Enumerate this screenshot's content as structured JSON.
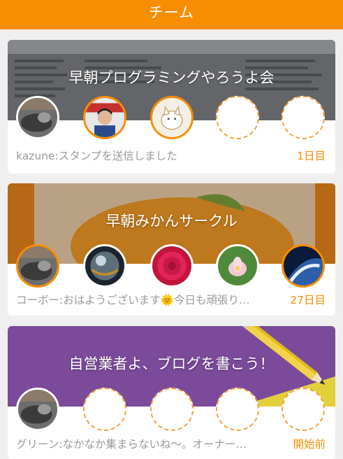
{
  "header": {
    "title": "チーム"
  },
  "teams": [
    {
      "name": "早朝プログラミングやろうよ会",
      "last_message": "kazune:スタンプを送信しました",
      "status": "1日目",
      "members": [
        "cat-photo",
        "person-photo",
        "cat-drawing",
        "empty",
        "empty"
      ]
    },
    {
      "name": "早朝みかんサークル",
      "last_message": "コーボー:おはようございます🌞今日も頑張り…",
      "status": "27日目",
      "members": [
        "cat-photo",
        "sphere-photo",
        "rose-photo",
        "lotus-photo",
        "earth-photo"
      ]
    },
    {
      "name": "自営業者よ、ブログを書こう！",
      "last_message": "グリーン:なかなか集まらないね〜。オーナー…",
      "status": "開始前",
      "members": [
        "cat-photo",
        "empty",
        "empty",
        "empty",
        "empty"
      ]
    }
  ],
  "colors": {
    "accent": "#f78d00",
    "purple": "#7b4a9a",
    "orange_banner": "#e8921e"
  }
}
